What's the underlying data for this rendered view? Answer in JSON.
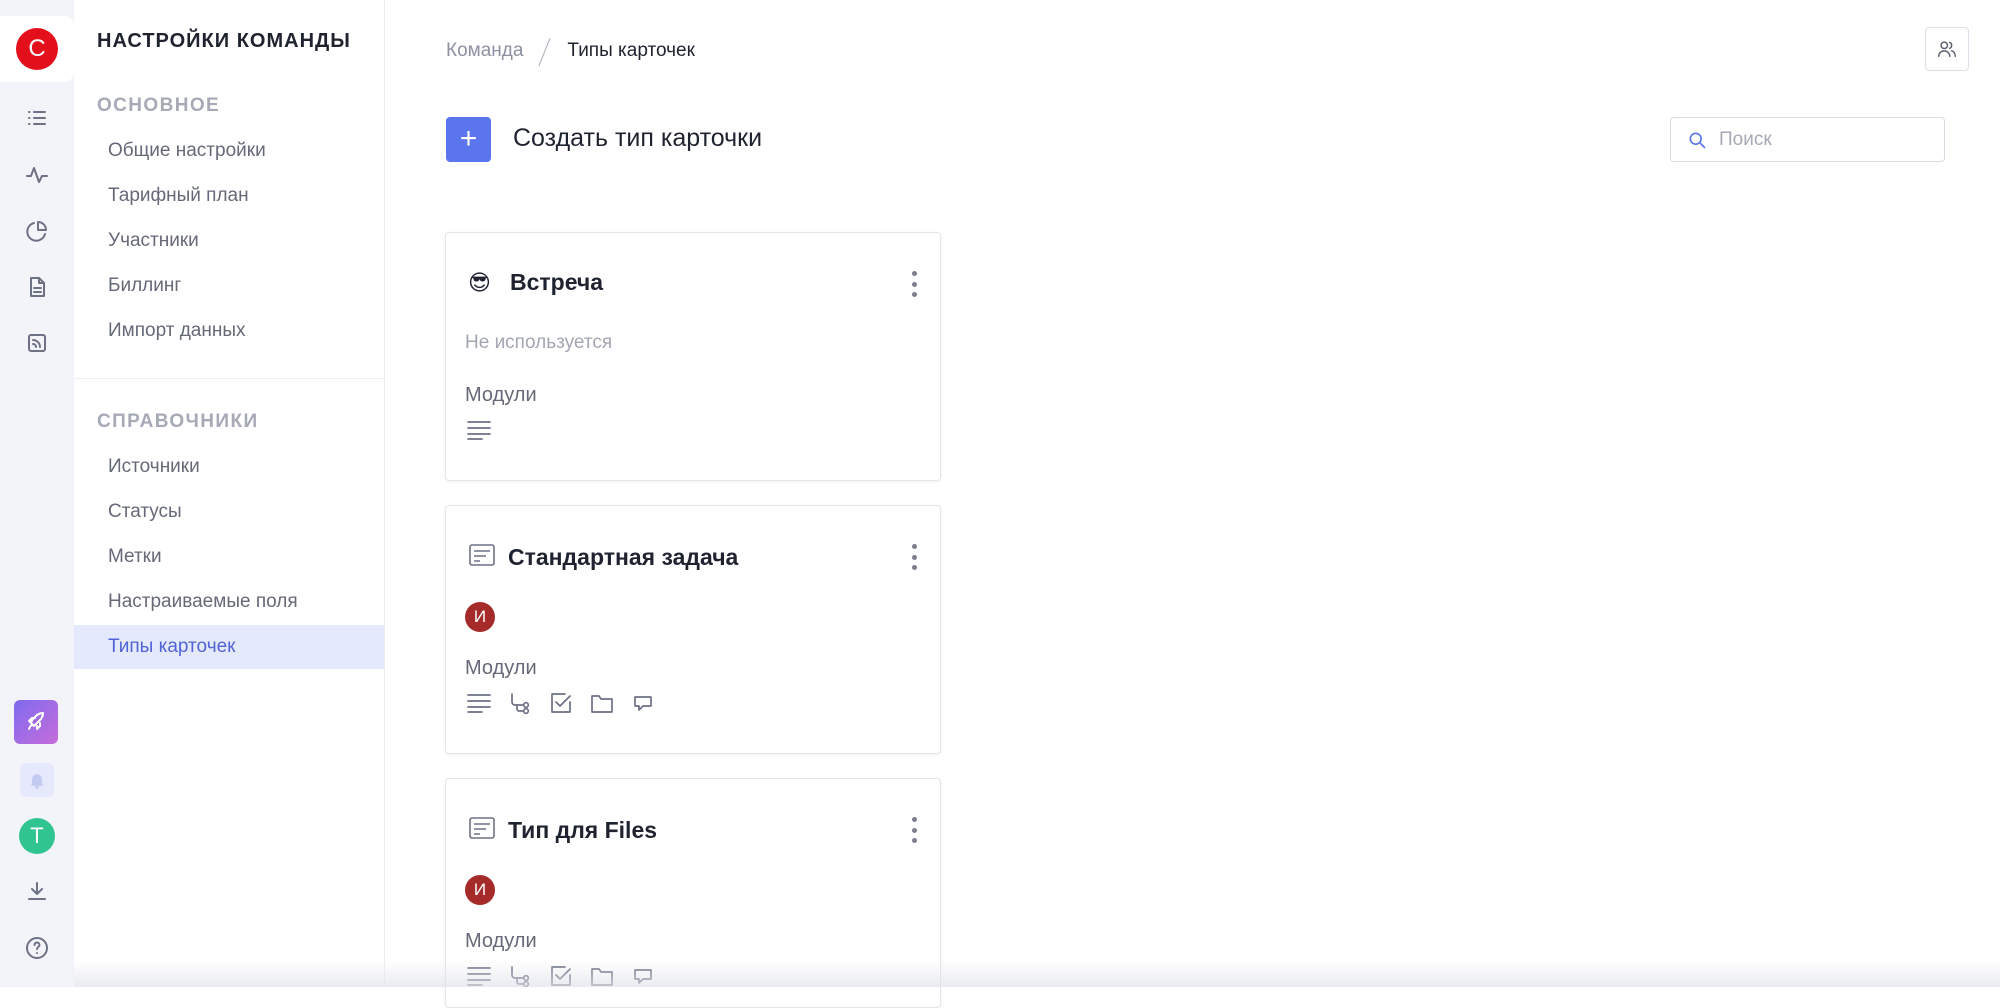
{
  "rail": {
    "logo_letter": "C",
    "user_initial": "T",
    "colors": {
      "logo": "#e3101c",
      "user_avatar": "#2fc490",
      "rocket": "#8b6cf0"
    },
    "icons": [
      "list-icon",
      "activity-icon",
      "pie-chart-icon",
      "document-icon",
      "rss-icon",
      "rocket-icon",
      "bell-icon",
      "download-icon",
      "help-icon"
    ]
  },
  "sidebar": {
    "title": "НАСТРОЙКИ КОМАНДЫ",
    "sections": [
      {
        "title": "ОСНОВНОЕ",
        "items": [
          "Общие настройки",
          "Тарифный план",
          "Участники",
          "Биллинг",
          "Импорт данных"
        ]
      },
      {
        "title": "СПРАВОЧНИКИ",
        "items": [
          "Источники",
          "Статусы",
          "Метки",
          "Настраиваемые поля",
          "Типы карточек"
        ]
      }
    ],
    "active_item": "Типы карточек"
  },
  "breadcrumb": {
    "parent": "Команда",
    "current": "Типы карточек"
  },
  "toolbar": {
    "create_label": "Создать тип карточки",
    "create_symbol": "+"
  },
  "search": {
    "placeholder": "Поиск",
    "value": ""
  },
  "cards": [
    {
      "emoji": "😎",
      "title": "Встреча",
      "status": "Не используется",
      "modules_label": "Модули",
      "modules": [
        "description-icon"
      ]
    },
    {
      "icon": "card-type-icon",
      "title": "Стандартная задача",
      "owner_initial": "И",
      "modules_label": "Модули",
      "modules": [
        "description-icon",
        "subtasks-icon",
        "checklist-icon",
        "folder-icon",
        "comments-icon"
      ]
    },
    {
      "icon": "card-type-icon",
      "title": "Тип для Files",
      "owner_initial": "И",
      "modules_label": "Модули",
      "modules": [
        "description-icon",
        "subtasks-icon",
        "checklist-icon",
        "folder-icon",
        "comments-icon"
      ]
    }
  ],
  "colors": {
    "accent": "#5b76ec",
    "active_bg": "#e5e9fc",
    "owner_avatar": "#a52a2a"
  }
}
